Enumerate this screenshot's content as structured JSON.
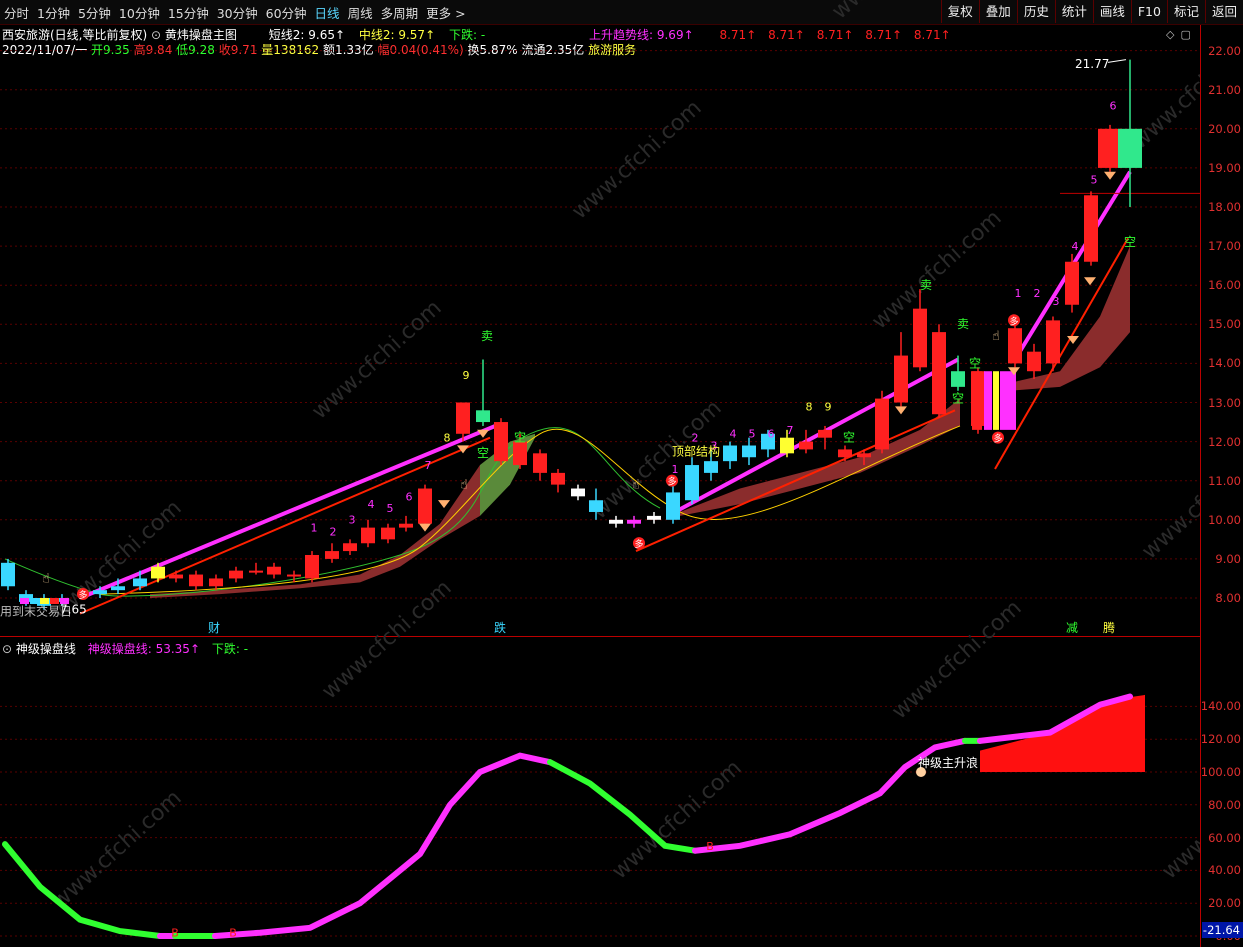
{
  "toolbar": {
    "periods": [
      "分时",
      "1分钟",
      "5分钟",
      "10分钟",
      "15分钟",
      "30分钟",
      "60分钟",
      "日线",
      "周线",
      "多周期",
      "更多 >"
    ],
    "active_period": "日线",
    "right_buttons": [
      "复权",
      "叠加",
      "历史",
      "统计",
      "画线",
      "F10",
      "标记",
      "返回"
    ]
  },
  "header": {
    "stock_name": "西安旅游(日线,等比前复权)",
    "indicator_name": "黄炜操盘主图",
    "short_line": "短线2: 9.65↑",
    "mid_line": "中线2: 9.57↑",
    "down_label": "下跌: -",
    "trend_line": "上升趋势线: 9.69↑",
    "ref_values": [
      "8.71↑",
      "8.71↑",
      "8.71↑",
      "8.71↑",
      "8.71↑"
    ],
    "date": "2022/11/07/一",
    "open": "开9.35",
    "high": "高9.84",
    "low": "低9.28",
    "close": "收9.71",
    "volume": "量138162",
    "amount": "额1.33亿",
    "change": "幅0.04(0.41%)",
    "turnover": "换5.87%",
    "float": "流通2.35亿",
    "sector": "旅游服务"
  },
  "main_chart": {
    "price_ticks": [
      "22.00",
      "21.00",
      "20.00",
      "19.00",
      "18.00",
      "17.00",
      "16.00",
      "15.00",
      "14.00",
      "13.00",
      "12.00",
      "11.00",
      "10.00",
      "9.00",
      "8.00"
    ],
    "max_label": "21.77",
    "min_label": "7.65",
    "bottom_markers": [
      "财",
      "跌",
      "减",
      "腾"
    ],
    "annotations": [
      "顶部结构",
      "用到末交易日"
    ],
    "signals": {
      "buy": "多",
      "sell": "卖",
      "empty": "空"
    },
    "count_labels": [
      "1",
      "2",
      "3",
      "4",
      "5",
      "6",
      "7",
      "8",
      "9"
    ]
  },
  "sub_chart": {
    "title": "神级操盘线",
    "line_label": "神级操盘线: 53.35↑",
    "down_label": "下跌: -",
    "ticks": [
      "140.00",
      "120.00",
      "100.00",
      "80.00",
      "60.00",
      "40.00",
      "20.00",
      "0.00"
    ],
    "last_value": "-21.64",
    "wave_label": "神级主升浪",
    "b_markers": [
      "B",
      "B",
      "B"
    ]
  },
  "watermark": "www.cfchi.com",
  "colors": {
    "up": "#ff2020",
    "down": "#3ad7ff",
    "magenta": "#ff30ff",
    "green": "#30ff30",
    "axis": "#e03030"
  }
}
